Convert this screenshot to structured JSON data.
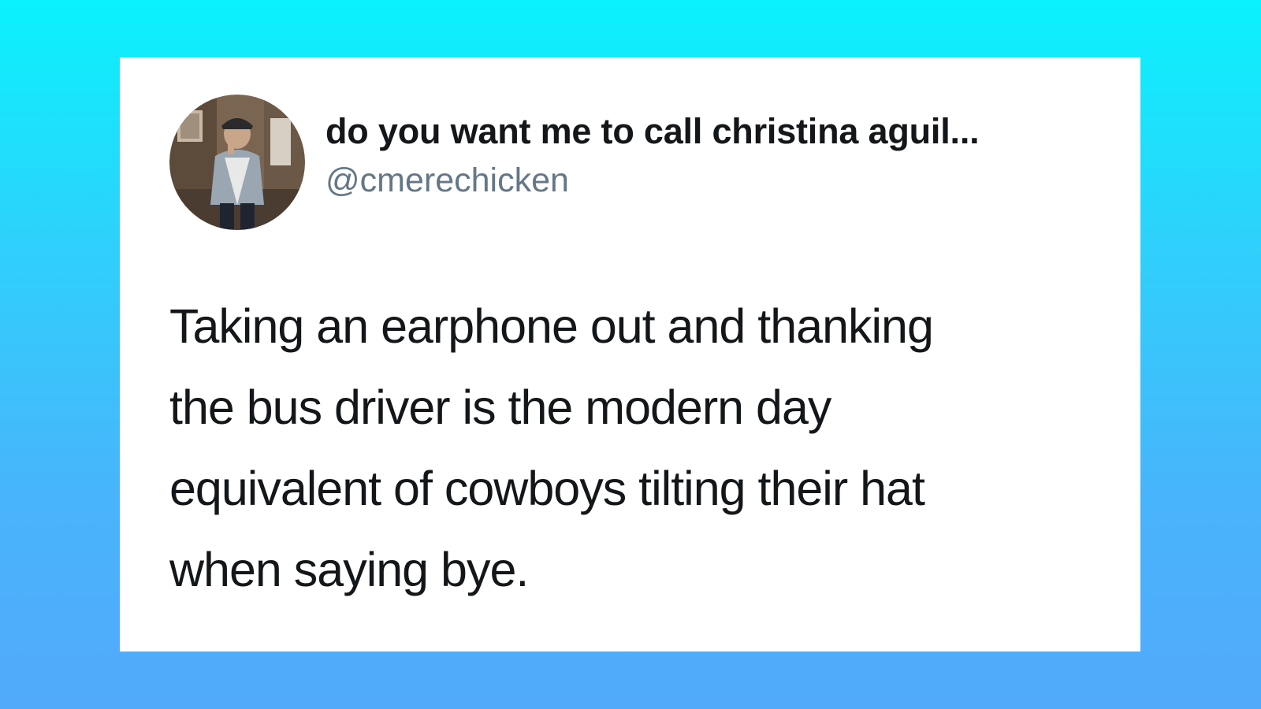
{
  "tweet": {
    "display_name": "do you want me to call christina aguil...",
    "handle": "@cmerechicken",
    "avatar_icon": "profile-photo-person-avatar",
    "text_lines": [
      "Taking an earphone out and thanking",
      "the bus driver is the modern day",
      "equivalent of cowboys tilting their hat",
      "when saying bye."
    ]
  },
  "colors": {
    "background_top": "#0af2fd",
    "background_bottom": "#52aafb",
    "card": "#ffffff",
    "name_text": "#14171a",
    "handle_text": "#657786"
  }
}
